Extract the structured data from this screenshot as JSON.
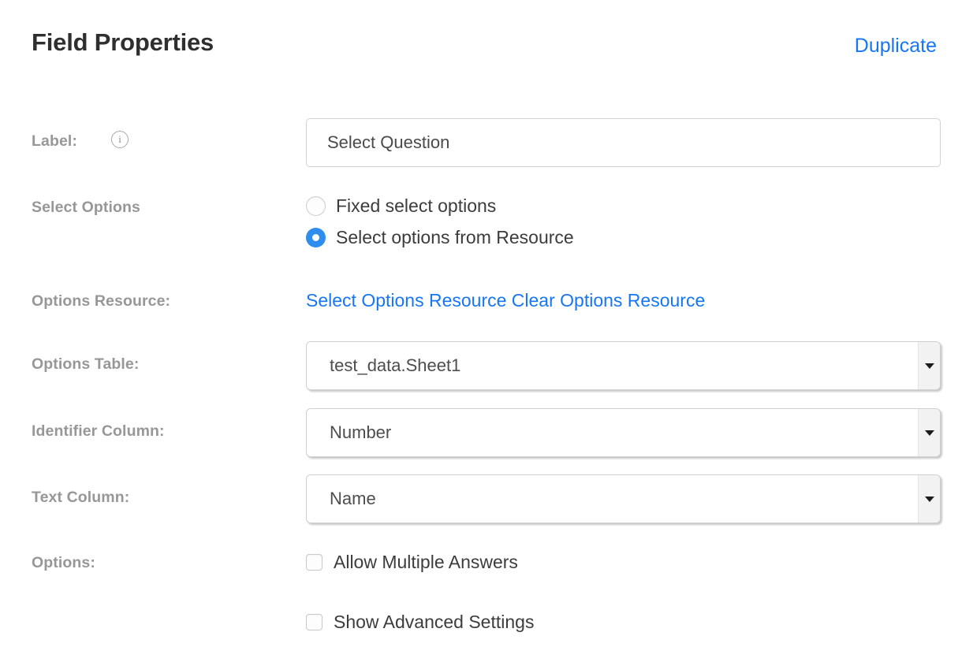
{
  "header": {
    "title": "Field Properties",
    "duplicate_label": "Duplicate",
    "link_color": "#1676f3"
  },
  "form": {
    "label_row": {
      "label": "Label:",
      "info_icon": "info-icon",
      "info_glyph": "i",
      "value": "Select Question",
      "placeholder": "Select Question"
    },
    "select_options_row": {
      "label": "Select Options",
      "options": [
        {
          "label": "Fixed select options",
          "selected": false
        },
        {
          "label": "Select options from Resource",
          "selected": true
        }
      ],
      "selected_color": "#2e8ded"
    },
    "options_resource_row": {
      "label": "Options Resource:",
      "select_link": "Select Options Resource",
      "clear_link": "Clear Options Resource"
    },
    "options_table_row": {
      "label": "Options Table:",
      "value": "test_data.Sheet1",
      "arrow_icon": "chevron-down-icon"
    },
    "identifier_column_row": {
      "label": "Identifier Column:",
      "value": "Number",
      "arrow_icon": "chevron-down-icon"
    },
    "text_column_row": {
      "label": "Text Column:",
      "value": "Name",
      "arrow_icon": "chevron-down-icon"
    },
    "options_row": {
      "label": "Options:",
      "checkboxes": [
        {
          "label": "Allow Multiple Answers",
          "checked": false
        },
        {
          "label": "Show Advanced Settings",
          "checked": false
        }
      ]
    }
  }
}
